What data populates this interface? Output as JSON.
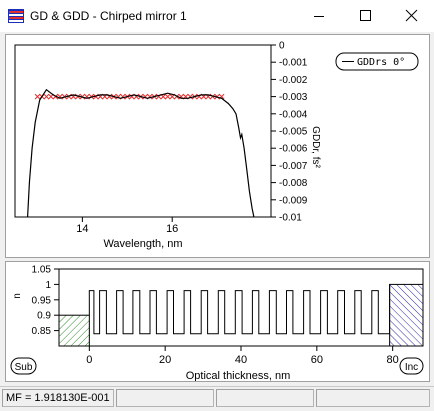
{
  "window": {
    "title": "GD & GDD - Chirped mirror 1",
    "icon": "layers-app-icon",
    "controls": [
      "minimize-icon",
      "maximize-icon",
      "close-icon"
    ]
  },
  "gdd_chart": {
    "xlabel": "Wavelength, nm",
    "ylabel": "GDDr, fs²",
    "x_ticks": [
      "14",
      "16"
    ],
    "y_ticks": [
      "0",
      "-0.001",
      "-0.002",
      "-0.003",
      "-0.004",
      "-0.005",
      "-0.006",
      "-0.007",
      "-0.008",
      "-0.009",
      "-0.01"
    ],
    "legend": "GDDrs 0°"
  },
  "index_chart": {
    "xlabel": "Optical thickness, nm",
    "ylabel": "n",
    "x_ticks": [
      "0",
      "20",
      "40",
      "60",
      "80"
    ],
    "y_ticks": [
      "1.05",
      "1",
      "0.95",
      "0.9",
      "0.85"
    ],
    "sub_label": "Sub",
    "inc_label": "Inc"
  },
  "status": {
    "mf": "MF = 1.918130E-001"
  },
  "chart_data": [
    {
      "type": "line",
      "xlabel": "Wavelength, nm",
      "ylabel": "GDDr, fs²",
      "xlim": [
        12.5,
        18.2
      ],
      "ylim": [
        -0.01,
        0
      ],
      "x_ticks": [
        14,
        16
      ],
      "series": [
        {
          "name": "GDDrs 0°",
          "x": [
            12.78,
            12.82,
            12.88,
            12.95,
            13.05,
            13.2,
            13.35,
            13.5,
            13.65,
            13.8,
            13.95,
            14.1,
            14.25,
            14.4,
            14.55,
            14.7,
            14.85,
            15.0,
            15.15,
            15.3,
            15.45,
            15.6,
            15.75,
            15.9,
            16.05,
            16.2,
            16.35,
            16.5,
            16.65,
            16.8,
            16.95,
            17.1,
            17.25,
            17.35,
            17.42,
            17.48,
            17.52,
            17.55,
            17.6,
            17.66,
            17.72,
            17.78,
            17.82
          ],
          "y": [
            -0.01,
            -0.008,
            -0.006,
            -0.0045,
            -0.0032,
            -0.0026,
            -0.0029,
            -0.0031,
            -0.003,
            -0.0029,
            -0.003,
            -0.0031,
            -0.003,
            -0.0029,
            -0.0029,
            -0.003,
            -0.0031,
            -0.003,
            -0.0029,
            -0.003,
            -0.0031,
            -0.003,
            -0.0029,
            -0.0028,
            -0.0029,
            -0.0031,
            -0.0031,
            -0.003,
            -0.0029,
            -0.0029,
            -0.003,
            -0.0031,
            -0.0034,
            -0.0037,
            -0.004,
            -0.0048,
            -0.0054,
            -0.0052,
            -0.006,
            -0.0072,
            -0.0085,
            -0.0095,
            -0.01
          ]
        },
        {
          "name": "",
          "type": "scatter",
          "x": [
            13.0,
            13.1,
            13.2,
            13.3,
            13.4,
            13.5,
            13.6,
            13.7,
            13.8,
            13.9,
            14.0,
            14.1,
            14.2,
            14.3,
            14.4,
            14.5,
            14.6,
            14.7,
            14.8,
            14.9,
            15.0,
            15.1,
            15.2,
            15.3,
            15.4,
            15.5,
            15.6,
            15.7,
            15.8,
            15.9,
            16.0,
            16.1,
            16.2,
            16.3,
            16.4,
            16.5,
            16.6,
            16.7,
            16.8,
            16.9,
            17.0,
            17.1
          ],
          "y": [
            -0.003,
            -0.003,
            -0.003,
            -0.003,
            -0.003,
            -0.003,
            -0.003,
            -0.003,
            -0.003,
            -0.003,
            -0.003,
            -0.003,
            -0.003,
            -0.003,
            -0.003,
            -0.003,
            -0.003,
            -0.003,
            -0.003,
            -0.003,
            -0.003,
            -0.003,
            -0.003,
            -0.003,
            -0.003,
            -0.003,
            -0.003,
            -0.003,
            -0.003,
            -0.003,
            -0.003,
            -0.003,
            -0.003,
            -0.003,
            -0.003,
            -0.003,
            -0.003,
            -0.003,
            -0.003,
            -0.003,
            -0.003,
            -0.003
          ]
        }
      ],
      "legend_position": "top-right",
      "grid": false
    },
    {
      "type": "line",
      "xlabel": "Optical thickness, nm",
      "ylabel": "n",
      "xlim": [
        -8,
        88
      ],
      "ylim": [
        0.8,
        1.05
      ],
      "x_ticks": [
        0,
        20,
        40,
        60,
        80
      ],
      "y_ticks": [
        1.05,
        1,
        0.95,
        0.9,
        0.85
      ],
      "substrate_index": 0.9,
      "incident_index": 1.0,
      "layers": {
        "high": 0.98,
        "low": 0.84,
        "boundaries": [
          0,
          1.2,
          2.7,
          4.5,
          7.2,
          8.9,
          11.5,
          13.3,
          16.0,
          17.7,
          20.5,
          22.2,
          25.0,
          26.7,
          29.5,
          31.2,
          34.0,
          35.7,
          38.5,
          40.3,
          43.0,
          44.7,
          47.5,
          49.3,
          52.0,
          53.7,
          56.5,
          58.2,
          61.0,
          62.8,
          65.5,
          67.3,
          70.0,
          71.7,
          74.5,
          76.2,
          79.2
        ],
        "first": "high"
      }
    }
  ]
}
